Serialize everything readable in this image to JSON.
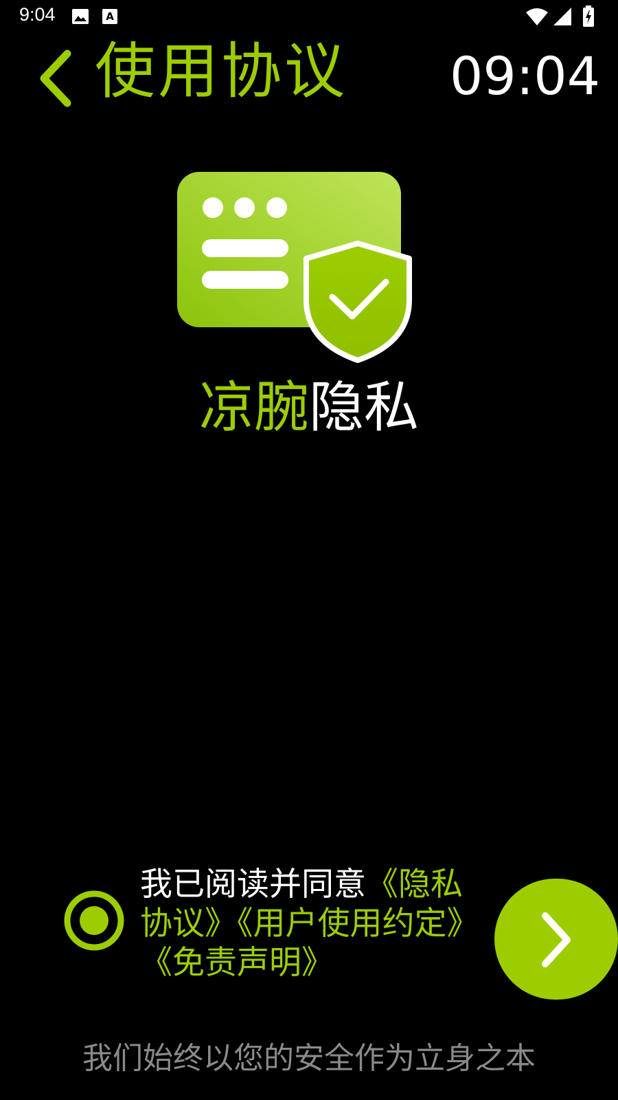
{
  "status_bar": {
    "time": "9:04",
    "icons": [
      "image-icon",
      "keyboard-a-icon",
      "wifi-icon",
      "signal-icon",
      "battery-charging-icon"
    ]
  },
  "header": {
    "back_icon": "chevron-left-icon",
    "title": "使用协议",
    "clock": "09:04"
  },
  "hero": {
    "icon": "privacy-shield-card-icon",
    "brand_part1": "凉腕",
    "brand_part2": "隐私"
  },
  "agreement": {
    "radio_icon": "radio-selected-icon",
    "prefix": "我已阅读并同意",
    "links": [
      "《隐私协议》",
      "《用户使用约定》",
      "《免责声明》"
    ],
    "next_icon": "chevron-right-icon"
  },
  "footer": {
    "slogan": "我们始终以您的安全作为立身之本"
  },
  "colors": {
    "accent": "#9dcd00",
    "background": "#000000",
    "text": "#ffffff",
    "muted": "#8a8a8a"
  }
}
